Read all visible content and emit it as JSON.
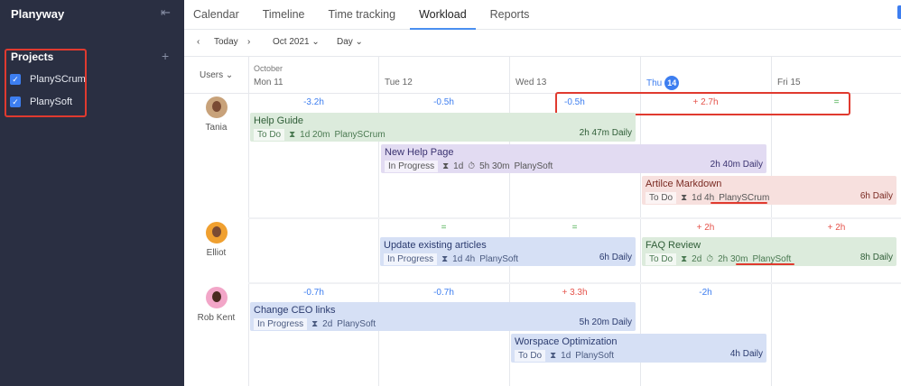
{
  "sidebar": {
    "brand": "Planyway",
    "projects_title": "Projects",
    "projects": [
      {
        "name": "PlanySCrum",
        "checked": true
      },
      {
        "name": "PlanySoft",
        "checked": true
      }
    ]
  },
  "tabs": [
    "Calendar",
    "Timeline",
    "Time tracking",
    "Workload",
    "Reports"
  ],
  "active_tab": "Workload",
  "toolbar": {
    "prev": "‹",
    "today": "Today",
    "next": "›",
    "month": "Oct 2021 ⌄",
    "view": "Day ⌄"
  },
  "header": {
    "users_label": "Users ⌄",
    "month": "October",
    "days": [
      "Mon 11",
      "Tue 12",
      "Wed 13",
      "Thu",
      "Fri 15"
    ],
    "today_num": "14"
  },
  "users": [
    {
      "name": "Tania",
      "totals": [
        "-3.2h",
        "-0.5h",
        "-0.5h",
        "+ 2.7h",
        "="
      ]
    },
    {
      "name": "Elliot",
      "totals": [
        "",
        "=",
        "=",
        "+ 2h",
        "+ 2h"
      ]
    },
    {
      "name": "Rob Kent",
      "totals": [
        "-0.7h",
        "-0.7h",
        "+ 3.3h",
        "-2h",
        ""
      ]
    }
  ],
  "tasks": [
    {
      "title": "Help Guide",
      "status": "To Do",
      "estimate": "1d 20m",
      "tracked": "",
      "project": "PlanySCrum",
      "daily": "2h 47m Daily"
    },
    {
      "title": "New Help Page",
      "status": "In Progress",
      "estimate": "1d",
      "tracked": "5h 30m",
      "project": "PlanySoft",
      "daily": "2h 40m Daily"
    },
    {
      "title": "Artilce Markdown",
      "status": "To Do",
      "estimate": "1d 4h",
      "tracked": "",
      "project": "PlanySCrum",
      "daily": "6h Daily"
    },
    {
      "title": "Update existing articles",
      "status": "In Progress",
      "estimate": "1d 4h",
      "tracked": "",
      "project": "PlanySoft",
      "daily": "6h Daily"
    },
    {
      "title": "FAQ Review",
      "status": "To Do",
      "estimate": "2d",
      "tracked": "2h 30m",
      "project": "PlanySoft",
      "daily": "8h Daily"
    },
    {
      "title": "Change CEO links",
      "status": "In Progress",
      "estimate": "2d",
      "tracked": "",
      "project": "PlanySoft",
      "daily": "5h 20m Daily"
    },
    {
      "title": "Worspace Optimization",
      "status": "To Do",
      "estimate": "1d",
      "tracked": "",
      "project": "PlanySoft",
      "daily": "4h Daily"
    }
  ],
  "icons": {
    "hourglass": "⧗",
    "timer": "⏱",
    "check": "✓",
    "plus": "+",
    "collapse": "⇤"
  }
}
